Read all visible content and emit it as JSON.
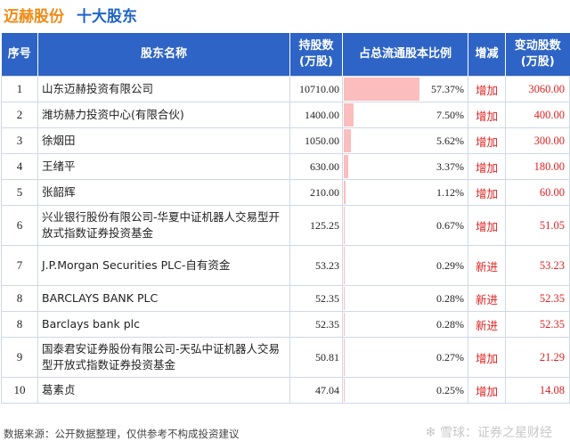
{
  "header": {
    "company": "迈赫股份",
    "section": "十大股东"
  },
  "columns": {
    "idx": "序号",
    "name": "股东名称",
    "shares_l1": "持股数",
    "shares_l2": "(万股)",
    "ratio": "占总流通股本比例",
    "change": "增减",
    "delta_l1": "变动股数",
    "delta_l2": "(万股)"
  },
  "rows": [
    {
      "idx": "1",
      "name": "山东迈赫投资有限公司",
      "shares": "10710.00",
      "ratio": "57.37%",
      "ratio_value": 57.37,
      "change": "增加",
      "delta": "3060.00"
    },
    {
      "idx": "2",
      "name": "潍坊赫力投资中心(有限合伙)",
      "shares": "1400.00",
      "ratio": "7.50%",
      "ratio_value": 7.5,
      "change": "增加",
      "delta": "400.00"
    },
    {
      "idx": "3",
      "name": "徐烟田",
      "shares": "1050.00",
      "ratio": "5.62%",
      "ratio_value": 5.62,
      "change": "增加",
      "delta": "300.00"
    },
    {
      "idx": "4",
      "name": "王绪平",
      "shares": "630.00",
      "ratio": "3.37%",
      "ratio_value": 3.37,
      "change": "增加",
      "delta": "180.00"
    },
    {
      "idx": "5",
      "name": "张韶辉",
      "shares": "210.00",
      "ratio": "1.12%",
      "ratio_value": 1.12,
      "change": "增加",
      "delta": "60.00"
    },
    {
      "idx": "6",
      "name": "兴业银行股份有限公司-华夏中证机器人交易型开放式指数证券投资基金",
      "shares": "125.25",
      "ratio": "0.67%",
      "ratio_value": 0.67,
      "change": "增加",
      "delta": "51.05"
    },
    {
      "idx": "7",
      "name": "J.P.Morgan Securities PLC-自有资金",
      "shares": "53.23",
      "ratio": "0.29%",
      "ratio_value": 0.29,
      "change": "新进",
      "delta": "53.23"
    },
    {
      "idx": "8",
      "name": "BARCLAYS BANK PLC",
      "shares": "52.35",
      "ratio": "0.28%",
      "ratio_value": 0.28,
      "change": "新进",
      "delta": "52.35"
    },
    {
      "idx": "8",
      "name": "Barclays bank plc",
      "shares": "52.35",
      "ratio": "0.28%",
      "ratio_value": 0.28,
      "change": "新进",
      "delta": "52.35"
    },
    {
      "idx": "9",
      "name": "国泰君安证券股份有限公司-天弘中证机器人交易型开放式指数证券投资基金",
      "shares": "50.81",
      "ratio": "0.27%",
      "ratio_value": 0.27,
      "change": "增加",
      "delta": "21.29"
    },
    {
      "idx": "10",
      "name": "葛素贞",
      "shares": "47.04",
      "ratio": "0.25%",
      "ratio_value": 0.25,
      "change": "增加",
      "delta": "14.08"
    }
  ],
  "footer": "数据来源：公开数据整理，仅供参考不构成投资建议",
  "watermark": "雪球：证券之星财经",
  "colors": {
    "header_bg": "#2e64c6",
    "accent_orange": "#f08a14",
    "title_blue": "#1f64c8",
    "up_red": "#e02020",
    "bar_pink": "#fbbdbd"
  }
}
